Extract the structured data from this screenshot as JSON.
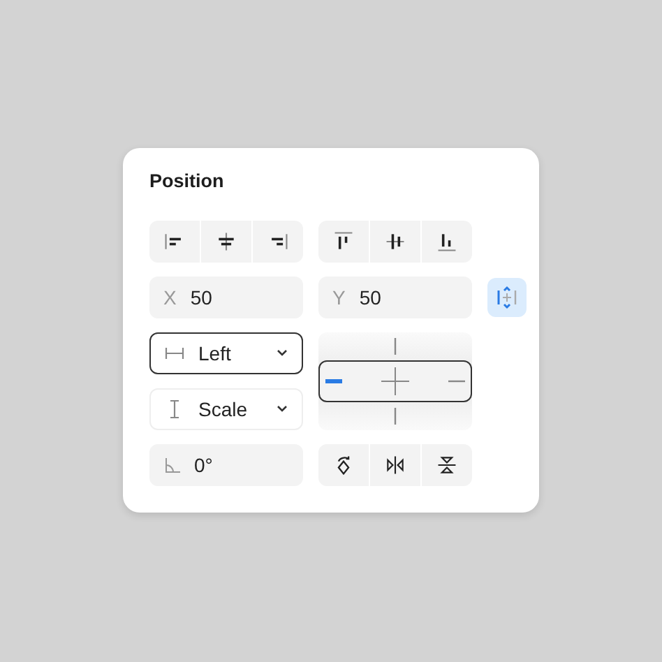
{
  "panel": {
    "title": "Position"
  },
  "horizontal_align": [
    {
      "kind": "left"
    },
    {
      "kind": "center"
    },
    {
      "kind": "right"
    }
  ],
  "vertical_align": [
    {
      "kind": "top"
    },
    {
      "kind": "middle"
    },
    {
      "kind": "bottom"
    }
  ],
  "x_field": {
    "label": "X",
    "value": "50"
  },
  "y_field": {
    "label": "Y",
    "value": "50"
  },
  "constrain_toggle": {
    "selected": true
  },
  "horizontal_constraint": {
    "value": "Left",
    "focused": true
  },
  "vertical_constraint": {
    "value": "Scale",
    "focused": false
  },
  "constraint_widget": {
    "focused": true,
    "sides": [
      {
        "kind": "left",
        "selected": true
      },
      {
        "kind": "right",
        "selected": false
      },
      {
        "kind": "top",
        "selected": false
      },
      {
        "kind": "bottom",
        "selected": false
      }
    ]
  },
  "rotation_field": {
    "value": "0°"
  },
  "transform_buttons": [
    {
      "kind": "rotate"
    },
    {
      "kind": "flip-horizontal"
    },
    {
      "kind": "flip-vertical"
    }
  ]
}
